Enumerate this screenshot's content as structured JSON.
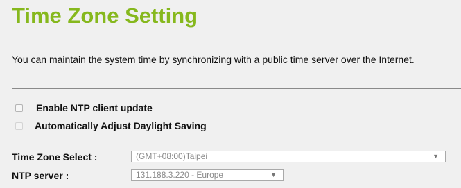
{
  "page": {
    "title": "Time Zone Setting",
    "description": "You can maintain the system time by synchronizing with a public time server over the Internet."
  },
  "options": {
    "ntp_client_update": {
      "label": "Enable NTP client update",
      "checked": false
    },
    "daylight_saving": {
      "label": "Automatically Adjust Daylight Saving",
      "checked": false
    }
  },
  "fields": {
    "time_zone": {
      "label": "Time Zone Select :",
      "value": "(GMT+08:00)Taipei"
    },
    "ntp_server": {
      "label": "NTP server :",
      "value": "131.188.3.220 - Europe"
    }
  },
  "colors": {
    "title_green": "#86b81d",
    "background": "#f0f0f0"
  },
  "icons": {
    "dropdown": "chevron-down-icon"
  }
}
